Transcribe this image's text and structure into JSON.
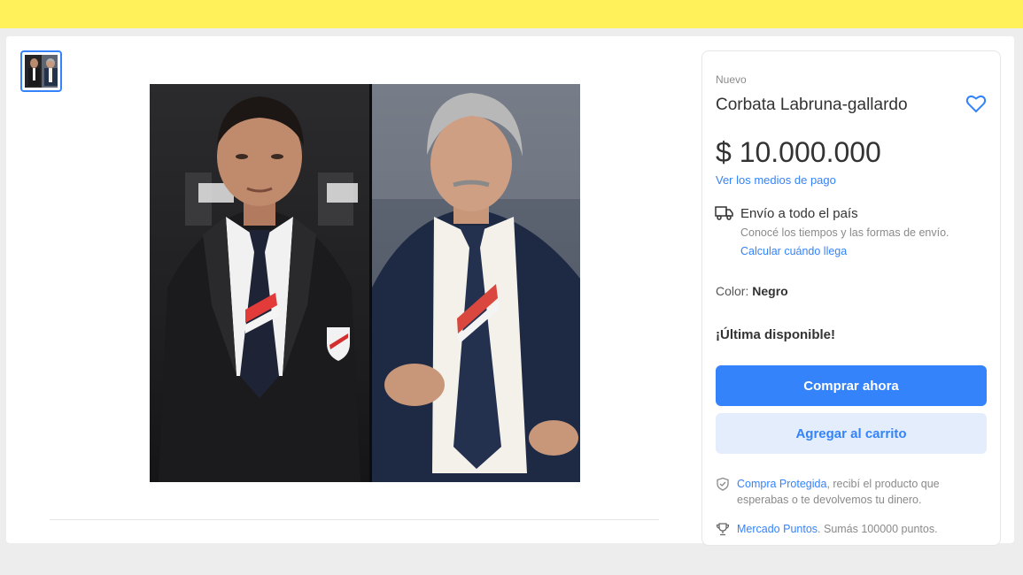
{
  "product": {
    "condition": "Nuevo",
    "title": "Corbata Labruna-gallardo",
    "price": "$ 10.000.000",
    "payment_link": "Ver los medios de pago"
  },
  "shipping": {
    "title": "Envío a todo el país",
    "subtitle": "Conocé los tiempos y las formas de envío.",
    "link": "Calcular cuándo llega"
  },
  "variant": {
    "label": "Color:",
    "value": "Negro"
  },
  "stock": "¡Última disponible!",
  "buttons": {
    "buy": "Comprar ahora",
    "cart": "Agregar al carrito"
  },
  "benefits": {
    "protected_link": "Compra Protegida",
    "protected_text": ", recibí el producto que esperabas o te devolvemos tu dinero.",
    "points_link": "Mercado Puntos",
    "points_text": ". Sumás 100000 puntos."
  },
  "icons": [
    "heart-icon",
    "truck-icon",
    "shield-icon",
    "trophy-icon"
  ],
  "colors": {
    "header_yellow": "#fff159",
    "accent_blue": "#3483fa",
    "secondary_button": "#e3edfb"
  }
}
